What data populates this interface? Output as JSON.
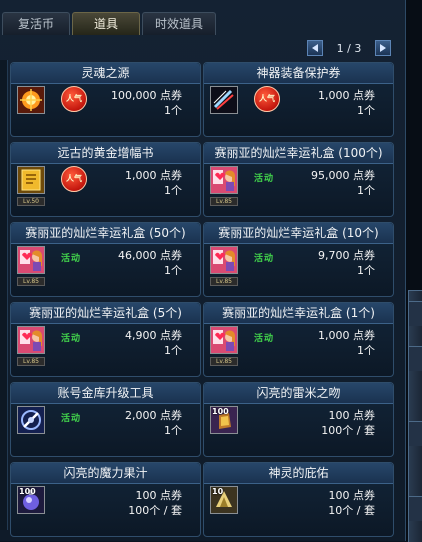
{
  "tabs": [
    {
      "label": "复活币",
      "active": false
    },
    {
      "label": "道具",
      "active": true
    },
    {
      "label": "时效道具",
      "active": false
    }
  ],
  "pager": {
    "text": "1 / 3"
  },
  "colors": {
    "accent": "#27476a",
    "event": "#42d44c",
    "hot": "#c4170e"
  },
  "items": [
    {
      "title": "灵魂之源",
      "price": "100,000 点券",
      "qty": "1个",
      "tag": "hot",
      "tag_text": "人气",
      "icon": "soul-source-icon",
      "level": ""
    },
    {
      "title": "神器装备保护券",
      "price": "1,000 点券",
      "qty": "1个",
      "tag": "hot",
      "tag_text": "人气",
      "icon": "artifact-protection-ticket-icon",
      "level": ""
    },
    {
      "title": "远古的黄金增幅书",
      "price": "1,000 点券",
      "qty": "1个",
      "tag": "hot",
      "tag_text": "人气",
      "icon": "golden-amplify-book-icon",
      "level": "Lv.50"
    },
    {
      "title": "赛丽亚的灿烂幸运礼盒 (100个)",
      "price": "95,000 点券",
      "qty": "1个",
      "tag": "event",
      "tag_text": "活动",
      "icon": "seria-gift-box-icon",
      "level": "Lv.85"
    },
    {
      "title": "赛丽亚的灿烂幸运礼盒 (50个)",
      "price": "46,000 点券",
      "qty": "1个",
      "tag": "event",
      "tag_text": "活动",
      "icon": "seria-gift-box-icon",
      "level": "Lv.85"
    },
    {
      "title": "赛丽亚的灿烂幸运礼盒 (10个)",
      "price": "9,700 点券",
      "qty": "1个",
      "tag": "event",
      "tag_text": "活动",
      "icon": "seria-gift-box-icon",
      "level": "Lv.85"
    },
    {
      "title": "赛丽亚的灿烂幸运礼盒 (5个)",
      "price": "4,900 点券",
      "qty": "1个",
      "tag": "event",
      "tag_text": "活动",
      "icon": "seria-gift-box-icon",
      "level": "Lv.85"
    },
    {
      "title": "赛丽亚的灿烂幸运礼盒 (1个)",
      "price": "1,000 点券",
      "qty": "1个",
      "tag": "event",
      "tag_text": "活动",
      "icon": "seria-gift-box-icon",
      "level": "Lv.85"
    },
    {
      "title": "账号金库升级工具",
      "price": "2,000 点券",
      "qty": "1个",
      "tag": "event",
      "tag_text": "活动",
      "icon": "vault-upgrade-tool-icon",
      "level": ""
    },
    {
      "title": "闪亮的雷米之吻",
      "price": "100 点券",
      "qty": "100个 / 套",
      "tag": "",
      "tag_text": "",
      "icon": "remy-kiss-icon",
      "level": "",
      "badge": "100"
    },
    {
      "title": "闪亮的魔力果汁",
      "price": "100 点券",
      "qty": "100个 / 套",
      "tag": "",
      "tag_text": "",
      "icon": "magic-juice-icon",
      "level": "",
      "badge": "100"
    },
    {
      "title": "神灵的庇佑",
      "price": "100 点券",
      "qty": "10个 / 套",
      "tag": "",
      "tag_text": "",
      "icon": "divine-blessing-icon",
      "level": "",
      "badge": "10"
    }
  ]
}
